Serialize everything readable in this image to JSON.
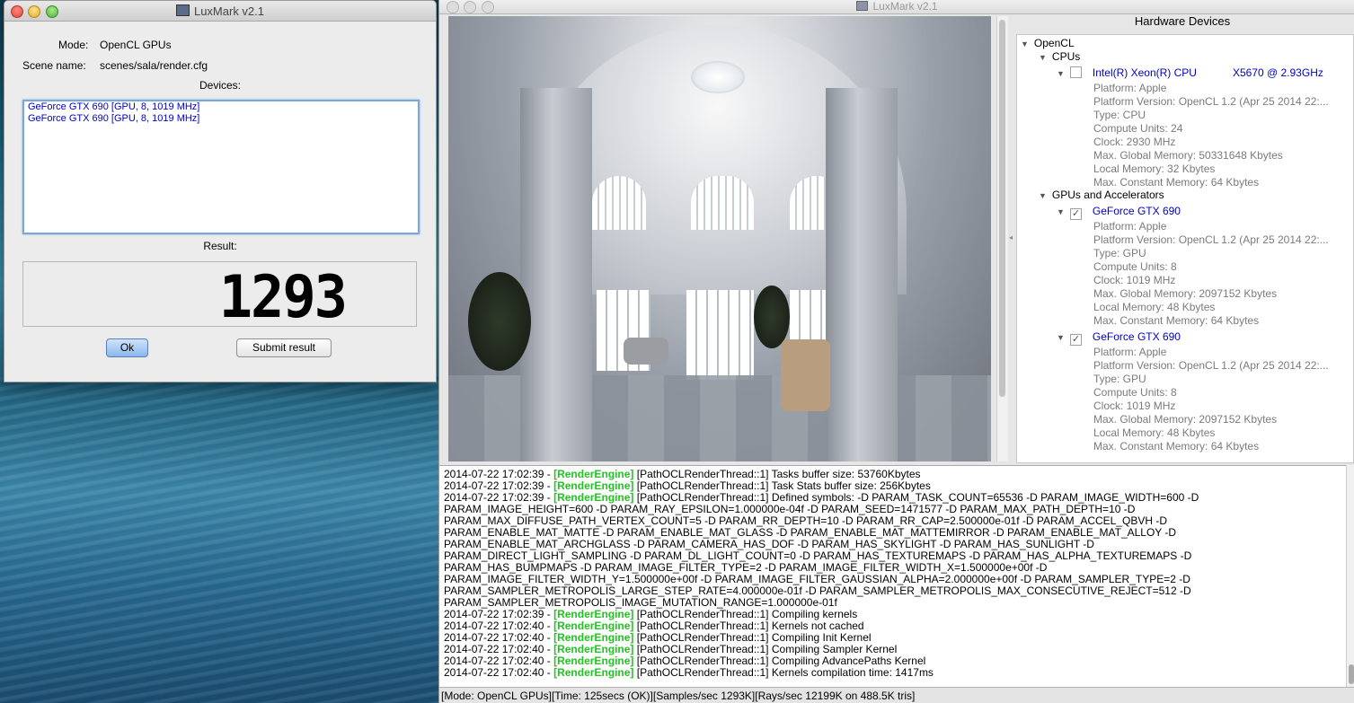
{
  "small_window": {
    "title": "LuxMark v2.1",
    "mode_label": "Mode:",
    "mode_value": "OpenCL GPUs",
    "scene_label": "Scene name:",
    "scene_value": "scenes/sala/render.cfg",
    "devices_label": "Devices:",
    "devices": [
      "GeForce GTX 690 [GPU, 8, 1019 MHz]",
      "GeForce GTX 690 [GPU, 8, 1019 MHz]"
    ],
    "result_label": "Result:",
    "result_value": "1293",
    "ok_label": "Ok",
    "submit_label": "Submit result"
  },
  "main_window": {
    "title": "LuxMark v2.1",
    "hardware_title": "Hardware Devices",
    "tree": {
      "root": "OpenCL",
      "cpus_group": "CPUs",
      "cpu": {
        "name": "Intel(R) Xeon(R) CPU",
        "name_suffix": "X5670  @ 2.93GHz",
        "checked": false,
        "props": [
          "Platform: Apple",
          "Platform Version: OpenCL 1.2 (Apr 25 2014 22:...",
          "Type: CPU",
          "Compute Units: 24",
          "Clock: 2930 MHz",
          "Max. Global Memory: 50331648 Kbytes",
          "Local Memory: 32 Kbytes",
          "Max. Constant Memory: 64 Kbytes"
        ]
      },
      "gpus_group": "GPUs and Accelerators",
      "gpus": [
        {
          "name": "GeForce GTX 690",
          "checked": true,
          "props": [
            "Platform: Apple",
            "Platform Version: OpenCL 1.2 (Apr 25 2014 22:...",
            "Type: GPU",
            "Compute Units: 8",
            "Clock: 1019 MHz",
            "Max. Global Memory: 2097152 Kbytes",
            "Local Memory: 48 Kbytes",
            "Max. Constant Memory: 64 Kbytes"
          ]
        },
        {
          "name": "GeForce GTX 690",
          "checked": true,
          "props": [
            "Platform: Apple",
            "Platform Version: OpenCL 1.2 (Apr 25 2014 22:...",
            "Type: GPU",
            "Compute Units: 8",
            "Clock: 1019 MHz",
            "Max. Global Memory: 2097152 Kbytes",
            "Local Memory: 48 Kbytes",
            "Max. Constant Memory: 64 Kbytes"
          ]
        }
      ]
    },
    "log": {
      "tag": "[RenderEngine]",
      "lines": [
        {
          "ts": "2014-07-22 17:02:39 - ",
          "tagged": true,
          "text": " [PathOCLRenderThread::1] Tasks buffer size: 53760Kbytes"
        },
        {
          "ts": "2014-07-22 17:02:39 - ",
          "tagged": true,
          "text": " [PathOCLRenderThread::1] Task Stats buffer size: 256Kbytes"
        },
        {
          "ts": "2014-07-22 17:02:39 - ",
          "tagged": true,
          "text": " [PathOCLRenderThread::1] Defined symbols: -D PARAM_TASK_COUNT=65536 -D PARAM_IMAGE_WIDTH=600 -D"
        },
        {
          "ts": "",
          "tagged": false,
          "text": "PARAM_IMAGE_HEIGHT=600 -D PARAM_RAY_EPSILON=1.000000e-04f -D PARAM_SEED=1471577 -D PARAM_MAX_PATH_DEPTH=10 -D"
        },
        {
          "ts": "",
          "tagged": false,
          "text": "PARAM_MAX_DIFFUSE_PATH_VERTEX_COUNT=5 -D PARAM_RR_DEPTH=10 -D PARAM_RR_CAP=2.500000e-01f -D PARAM_ACCEL_QBVH -D"
        },
        {
          "ts": "",
          "tagged": false,
          "text": "PARAM_ENABLE_MAT_MATTE -D PARAM_ENABLE_MAT_GLASS -D PARAM_ENABLE_MAT_MATTEMIRROR -D PARAM_ENABLE_MAT_ALLOY -D"
        },
        {
          "ts": "",
          "tagged": false,
          "text": "PARAM_ENABLE_MAT_ARCHGLASS -D PARAM_CAMERA_HAS_DOF -D PARAM_HAS_SKYLIGHT -D PARAM_HAS_SUNLIGHT -D"
        },
        {
          "ts": "",
          "tagged": false,
          "text": "PARAM_DIRECT_LIGHT_SAMPLING -D PARAM_DL_LIGHT_COUNT=0 -D PARAM_HAS_TEXTUREMAPS -D PARAM_HAS_ALPHA_TEXTUREMAPS -D"
        },
        {
          "ts": "",
          "tagged": false,
          "text": "PARAM_HAS_BUMPMAPS -D PARAM_IMAGE_FILTER_TYPE=2 -D PARAM_IMAGE_FILTER_WIDTH_X=1.500000e+00f -D"
        },
        {
          "ts": "",
          "tagged": false,
          "text": "PARAM_IMAGE_FILTER_WIDTH_Y=1.500000e+00f -D PARAM_IMAGE_FILTER_GAUSSIAN_ALPHA=2.000000e+00f -D PARAM_SAMPLER_TYPE=2 -D"
        },
        {
          "ts": "",
          "tagged": false,
          "text": "PARAM_SAMPLER_METROPOLIS_LARGE_STEP_RATE=4.000000e-01f -D PARAM_SAMPLER_METROPOLIS_MAX_CONSECUTIVE_REJECT=512 -D"
        },
        {
          "ts": "",
          "tagged": false,
          "text": "PARAM_SAMPLER_METROPOLIS_IMAGE_MUTATION_RANGE=1.000000e-01f"
        },
        {
          "ts": "2014-07-22 17:02:39 - ",
          "tagged": true,
          "text": " [PathOCLRenderThread::1] Compiling kernels"
        },
        {
          "ts": "2014-07-22 17:02:40 - ",
          "tagged": true,
          "text": " [PathOCLRenderThread::1] Kernels not cached"
        },
        {
          "ts": "2014-07-22 17:02:40 - ",
          "tagged": true,
          "text": " [PathOCLRenderThread::1] Compiling Init Kernel"
        },
        {
          "ts": "2014-07-22 17:02:40 - ",
          "tagged": true,
          "text": " [PathOCLRenderThread::1] Compiling Sampler Kernel"
        },
        {
          "ts": "2014-07-22 17:02:40 - ",
          "tagged": true,
          "text": " [PathOCLRenderThread::1] Compiling AdvancePaths Kernel"
        },
        {
          "ts": "2014-07-22 17:02:40 - ",
          "tagged": true,
          "text": " [PathOCLRenderThread::1] Kernels compilation time: 1417ms"
        }
      ]
    },
    "status_bar": "[Mode: OpenCL GPUs][Time: 125secs (OK)][Samples/sec   1293K][Rays/sec  12199K on 488.5K tris]"
  },
  "colors": {
    "device_text": "#0000c8",
    "render_engine_tag": "#22c422",
    "prop_text": "#7b7b7b"
  },
  "icons": {
    "close": "close-icon",
    "minimize": "minimize-icon",
    "zoom": "zoom-icon",
    "disclosure": "triangle-down-icon",
    "checkbox": "checkbox-icon"
  }
}
